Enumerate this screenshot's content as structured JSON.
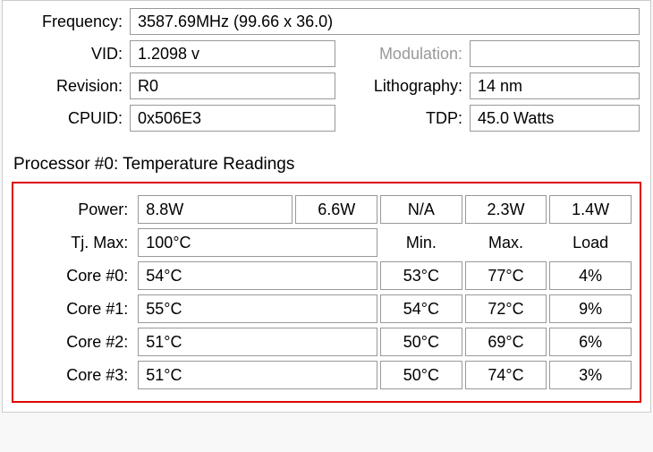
{
  "info": {
    "frequency_label": "Frequency:",
    "frequency_value": "3587.69MHz (99.66 x 36.0)",
    "vid_label": "VID:",
    "vid_value": "1.2098 v",
    "modulation_label": "Modulation:",
    "modulation_value": "",
    "revision_label": "Revision:",
    "revision_value": "R0",
    "lithography_label": "Lithography:",
    "lithography_value": "14 nm",
    "cpuid_label": "CPUID:",
    "cpuid_value": "0x506E3",
    "tdp_label": "TDP:",
    "tdp_value": "45.0 Watts"
  },
  "section_title": "Processor #0: Temperature Readings",
  "temp": {
    "power_label": "Power:",
    "power": [
      "8.8W",
      "6.6W",
      "N/A",
      "2.3W",
      "1.4W"
    ],
    "tjmax_label": "Tj. Max:",
    "tjmax_value": "100°C",
    "headers": [
      "Min.",
      "Max.",
      "Load"
    ],
    "cores": [
      {
        "label": "Core #0:",
        "current": "54°C",
        "min": "53°C",
        "max": "77°C",
        "load": "4%"
      },
      {
        "label": "Core #1:",
        "current": "55°C",
        "min": "54°C",
        "max": "72°C",
        "load": "9%"
      },
      {
        "label": "Core #2:",
        "current": "51°C",
        "min": "50°C",
        "max": "69°C",
        "load": "6%"
      },
      {
        "label": "Core #3:",
        "current": "51°C",
        "min": "50°C",
        "max": "74°C",
        "load": "3%"
      }
    ]
  }
}
